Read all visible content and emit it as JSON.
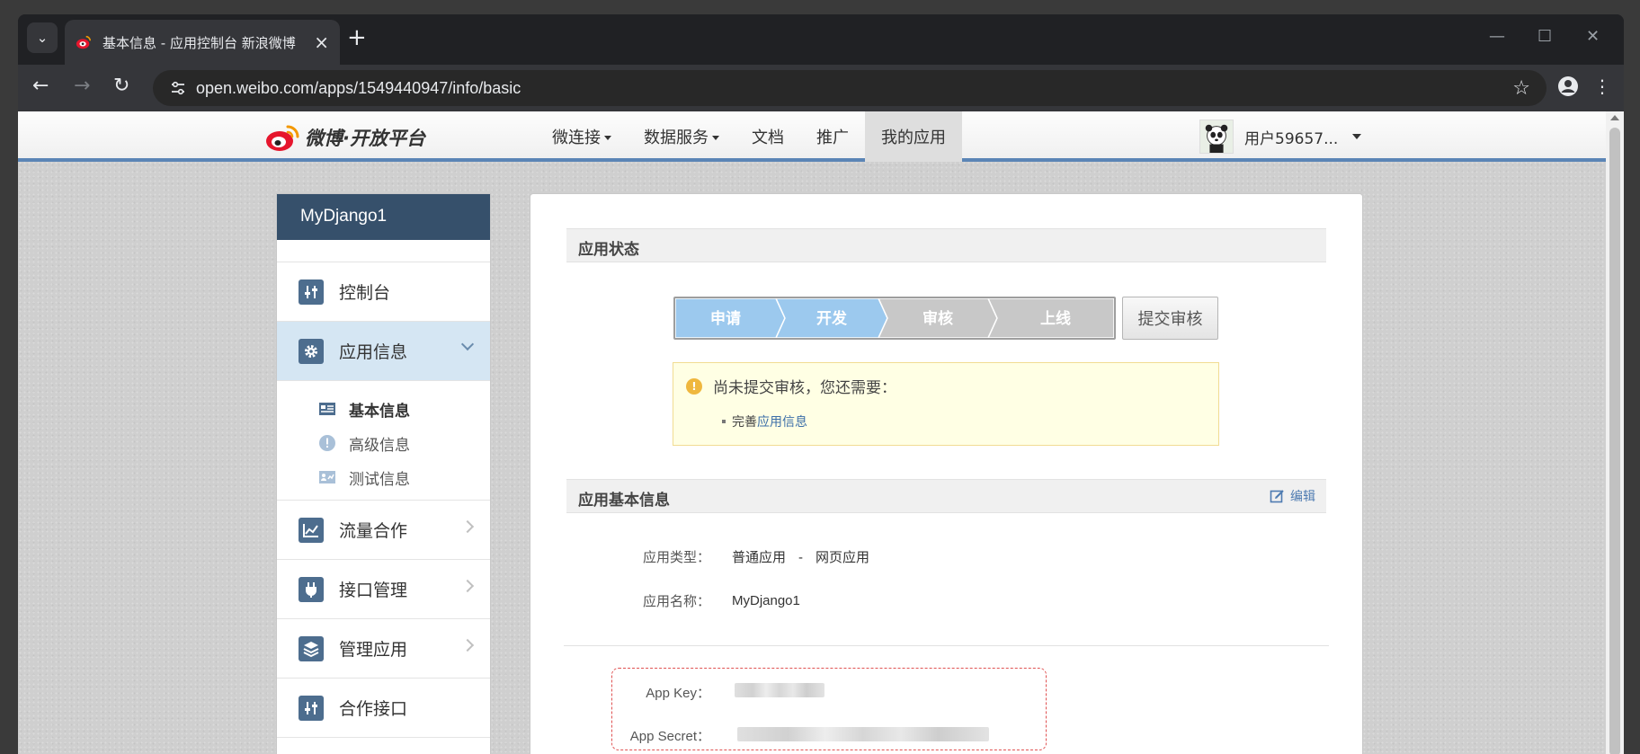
{
  "browser": {
    "tab_title": "基本信息 - 应用控制台 新浪微博",
    "url": "open.weibo.com/apps/1549440947/info/basic"
  },
  "header": {
    "logo_text": "微博·开放平台",
    "nav": [
      {
        "label": "微连接",
        "has_dropdown": true
      },
      {
        "label": "数据服务",
        "has_dropdown": true
      },
      {
        "label": "文档",
        "has_dropdown": false
      },
      {
        "label": "推广",
        "has_dropdown": false
      },
      {
        "label": "我的应用",
        "has_dropdown": false,
        "active": true
      }
    ],
    "username": "用户59657..."
  },
  "sidebar": {
    "app_name": "MyDjango1",
    "items": [
      {
        "label": "控制台",
        "icon": "sliders-icon"
      },
      {
        "label": "应用信息",
        "icon": "gear-icon",
        "active": true,
        "expanded": true
      },
      {
        "label": "流量合作",
        "icon": "chart-icon"
      },
      {
        "label": "接口管理",
        "icon": "plug-icon"
      },
      {
        "label": "管理应用",
        "icon": "layers-icon"
      },
      {
        "label": "合作接口",
        "icon": "sliders-icon"
      }
    ],
    "subitems": [
      {
        "label": "基本信息",
        "icon": "card-icon",
        "current": true
      },
      {
        "label": "高级信息",
        "icon": "info-icon"
      },
      {
        "label": "测试信息",
        "icon": "id-icon"
      }
    ]
  },
  "status": {
    "title": "应用状态",
    "steps": [
      "申请",
      "开发",
      "审核",
      "上线"
    ],
    "completed_steps": 2,
    "submit_label": "提交审核",
    "notice_text": "尚未提交审核，您还需要：",
    "notice_item_prefix": "完善",
    "notice_item_link": "应用信息"
  },
  "basic_info": {
    "title": "应用基本信息",
    "edit_label": "编辑",
    "type_label": "应用类型：",
    "type_value_1": "普通应用",
    "type_sep": "-",
    "type_value_2": "网页应用",
    "name_label": "应用名称：",
    "name_value": "MyDjango1",
    "app_key_label": "App Key：",
    "app_secret_label": "App Secret："
  },
  "colors": {
    "sidebar_header": "#36506b",
    "active_item": "#d5e6f3",
    "step_done": "#9cc9ee",
    "step_todo": "#c8c8c8",
    "link": "#3d6fa8",
    "highlight_border": "#e05252"
  }
}
